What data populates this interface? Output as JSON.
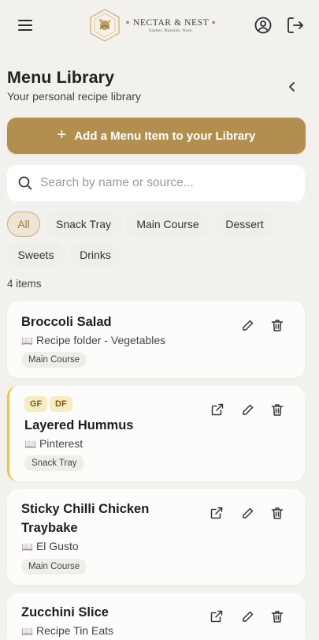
{
  "brand": {
    "name": "NECTAR & NEST",
    "tagline": "Gather. Nourish. Note."
  },
  "header": {
    "title": "Menu Library",
    "subtitle": "Your personal recipe library"
  },
  "add_button": {
    "label": "Add a Menu Item to your Library"
  },
  "search": {
    "placeholder": "Search by name or source..."
  },
  "filters": [
    {
      "label": "All",
      "active": true
    },
    {
      "label": "Snack Tray",
      "active": false
    },
    {
      "label": "Main Course",
      "active": false
    },
    {
      "label": "Dessert",
      "active": false
    },
    {
      "label": "Sweets",
      "active": false
    },
    {
      "label": "Drinks",
      "active": false
    }
  ],
  "count_label": "4 items",
  "recipes": [
    {
      "title": "Broccoli Salad",
      "source": "Recipe folder - Vegetables",
      "category": "Main Course",
      "badges": [],
      "has_link": false
    },
    {
      "title": "Layered Hummus",
      "source": "Pinterest",
      "category": "Snack Tray",
      "badges": [
        "GF",
        "DF"
      ],
      "has_link": true
    },
    {
      "title_line1": "Sticky Chilli Chicken",
      "title_line2": "Traybake",
      "source": "El Gusto",
      "category": "Main Course",
      "badges": [],
      "has_link": true
    },
    {
      "title": "Zucchini Slice",
      "source": "Recipe Tin Eats",
      "badges": [],
      "has_link": true
    }
  ],
  "colors": {
    "accent": "#b28f4f",
    "badge_bg": "#f8ecc5",
    "flag": "#f2c23a",
    "background": "#f3f1ee"
  },
  "icons": [
    "menu-icon",
    "account-icon",
    "logout-icon",
    "chevron-left-icon",
    "plus-icon",
    "search-icon",
    "external-link-icon",
    "edit-icon",
    "trash-icon",
    "book-icon"
  ]
}
